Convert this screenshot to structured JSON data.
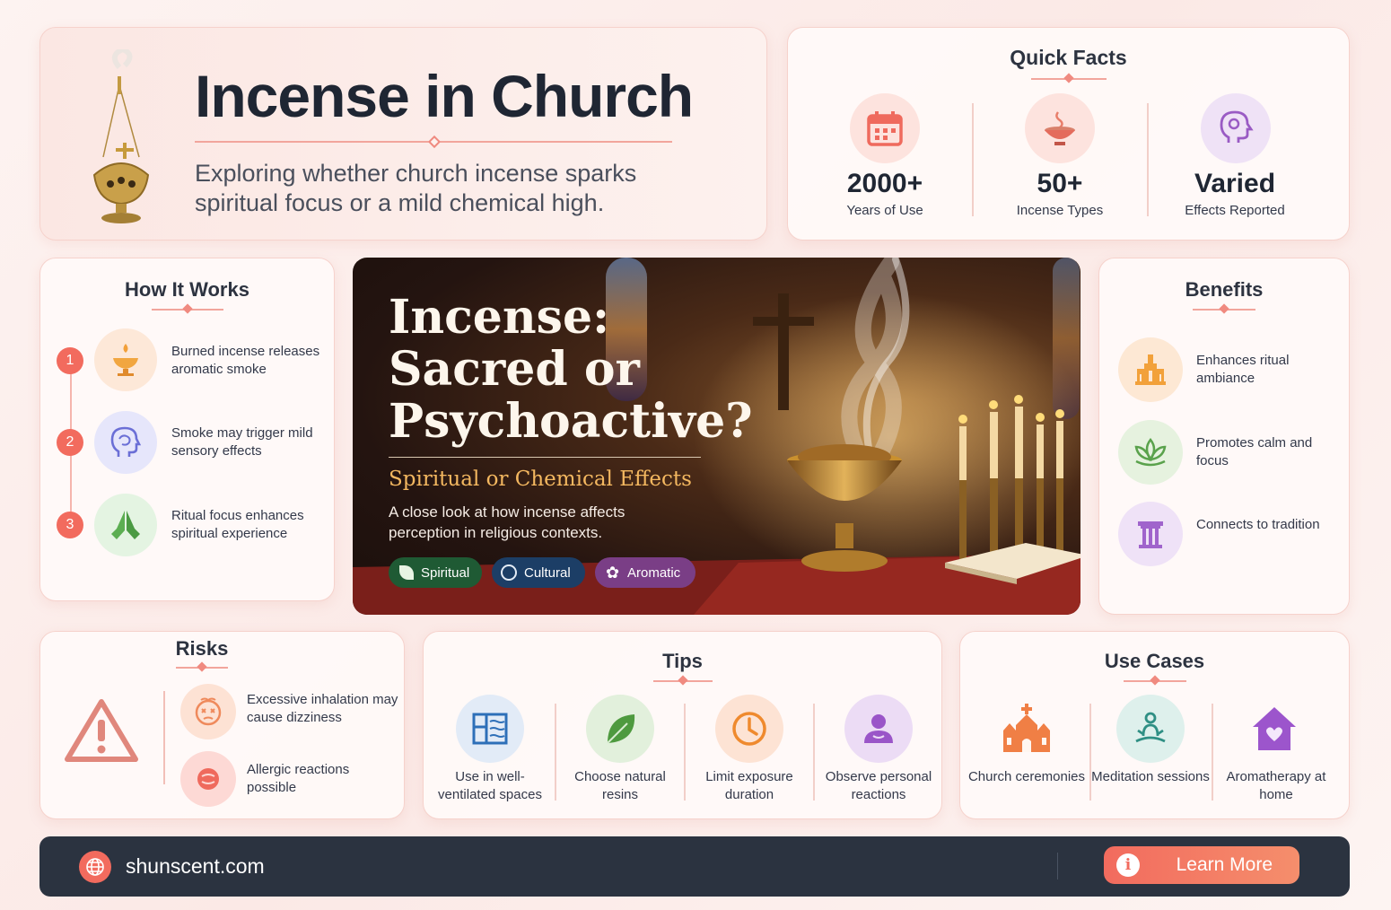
{
  "header": {
    "title": "Incense in Church",
    "subtitle": "Exploring whether church incense sparks spiritual focus or a mild chemical high."
  },
  "quick_facts": {
    "title": "Quick Facts",
    "items": [
      {
        "value": "2000+",
        "label": "Years of Use",
        "icon": "calendar-icon"
      },
      {
        "value": "50+",
        "label": "Incense Types",
        "icon": "incense-bowl-icon"
      },
      {
        "value": "Varied",
        "label": "Effects Reported",
        "icon": "head-profile-icon"
      }
    ]
  },
  "how_it_works": {
    "title": "How It Works",
    "steps": [
      {
        "num": "1",
        "text": "Burned incense releases aromatic smoke",
        "icon": "burner-icon"
      },
      {
        "num": "2",
        "text": "Smoke may trigger mild sensory effects",
        "icon": "brain-head-icon"
      },
      {
        "num": "3",
        "text": "Ritual focus enhances spiritual experience",
        "icon": "praying-hands-icon"
      }
    ]
  },
  "hero": {
    "title_line1": "Incense:",
    "title_line2": "Sacred or",
    "title_line3": "Psychoactive?",
    "subtitle": "Spiritual or Chemical Effects",
    "description": "A close look at how incense affects perception in religious contexts.",
    "tags": [
      {
        "label": "Spiritual",
        "color": "#1f5a34"
      },
      {
        "label": "Cultural",
        "color": "#1c3e66"
      },
      {
        "label": "Aromatic",
        "color": "#7a3e86"
      }
    ]
  },
  "benefits": {
    "title": "Benefits",
    "items": [
      {
        "text": "Enhances ritual ambiance",
        "icon": "temple-icon"
      },
      {
        "text": "Promotes calm and focus",
        "icon": "lotus-icon"
      },
      {
        "text": "Connects to tradition",
        "icon": "pillar-icon"
      }
    ]
  },
  "risks": {
    "title": "Risks",
    "items": [
      {
        "text": "Excessive inhalation may cause dizziness",
        "icon": "dizzy-face-icon"
      },
      {
        "text": "Allergic reactions possible",
        "icon": "allergy-icon"
      }
    ]
  },
  "tips": {
    "title": "Tips",
    "items": [
      {
        "text": "Use in well-ventilated spaces",
        "icon": "window-icon"
      },
      {
        "text": "Choose natural resins",
        "icon": "leaf-icon"
      },
      {
        "text": "Limit exposure duration",
        "icon": "clock-icon"
      },
      {
        "text": "Observe personal reactions",
        "icon": "person-icon"
      }
    ]
  },
  "use_cases": {
    "title": "Use Cases",
    "items": [
      {
        "text": "Church ceremonies",
        "icon": "church-icon"
      },
      {
        "text": "Meditation sessions",
        "icon": "meditation-icon"
      },
      {
        "text": "Aromatherapy at home",
        "icon": "home-icon"
      }
    ]
  },
  "footer": {
    "url": "shunscent.com",
    "button": "Learn More"
  }
}
